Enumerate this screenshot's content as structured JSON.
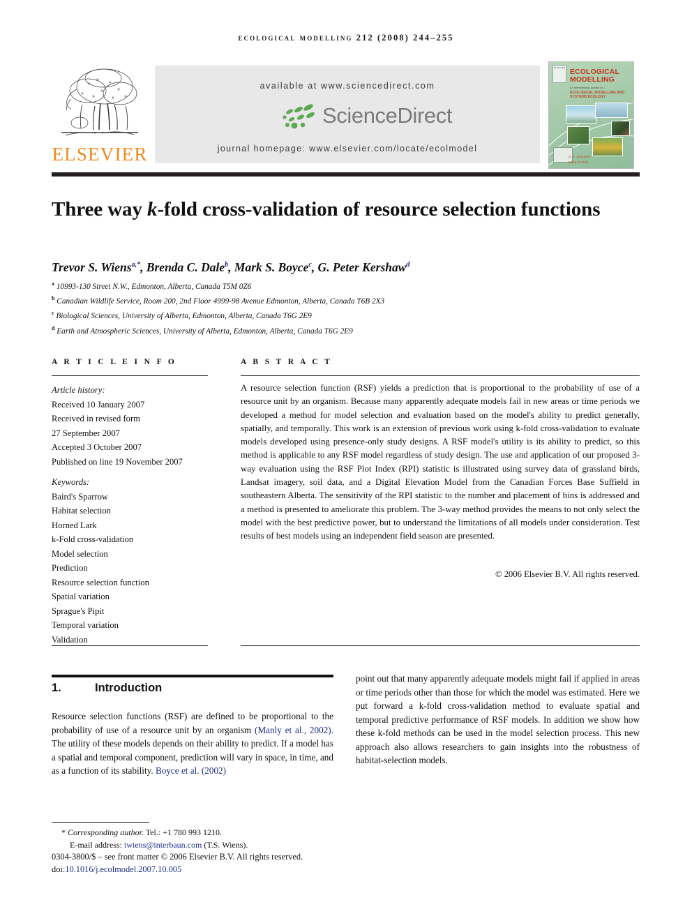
{
  "masthead": {
    "journal_header": "ECOLOGICAL MODELLING 212 (2008) 244–255",
    "elsevier_wordmark": "ELSEVIER",
    "elsevier_logo_icon": "elsevier-tree-icon",
    "sciencedirect": {
      "available_at": "available at www.sciencedirect.com",
      "logo_text": "ScienceDirect",
      "logo_icon": "sciencedirect-leaves-icon",
      "journal_homepage": "journal homepage: www.elsevier.com/locate/ecolmodel"
    },
    "cover": {
      "publisher_mark": "ELSEVIER",
      "title": "ECOLOGICAL MODELLING",
      "subtitle": "An International Journal on",
      "subtitle2": "ECOLOGICAL MODELLING AND SYSTEMS ECOLOGY",
      "editor1": "S. E. Jorgensen",
      "editor2": "Editor-in-Chief"
    }
  },
  "article": {
    "title_part1": "Three way ",
    "title_k": "k",
    "title_part2": "-fold cross-validation of resource selection functions",
    "authors": [
      {
        "name": "Trevor S. Wiens",
        "marks": "a,*"
      },
      {
        "name": "Brenda C. Dale",
        "marks": "b"
      },
      {
        "name": "Mark S. Boyce",
        "marks": "c"
      },
      {
        "name": "G. Peter Kershaw",
        "marks": "d"
      }
    ],
    "affiliations": [
      {
        "mark": "a",
        "text": "10993-130 Street N.W., Edmonton, Alberta, Canada T5M 0Z6"
      },
      {
        "mark": "b",
        "text": "Canadian Wildlife Service, Room 200, 2nd Floor 4999-98 Avenue Edmonton, Alberta, Canada T6B 2X3"
      },
      {
        "mark": "c",
        "text": "Biological Sciences, University of Alberta, Edmonton, Alberta, Canada T6G 2E9"
      },
      {
        "mark": "d",
        "text": "Earth and Atmospheric Sciences, University of Alberta, Edmonton, Alberta, Canada T6G 2E9"
      }
    ]
  },
  "article_info": {
    "heading": "A R T I C L E   I N F O",
    "history_label": "Article history:",
    "history": [
      "Received 10 January 2007",
      "Received in revised form",
      "27 September 2007",
      "Accepted 3 October 2007",
      "Published on line 19 November 2007"
    ],
    "keywords_label": "Keywords:",
    "keywords": [
      "Baird's Sparrow",
      "Habitat selection",
      "Horned Lark",
      "k-Fold cross-validation",
      "Model selection",
      "Prediction",
      "Resource selection function",
      "Spatial variation",
      "Sprague's Pipit",
      "Temporal variation",
      "Validation"
    ]
  },
  "abstract": {
    "heading": "A B S T R A C T",
    "body": "A resource selection function (RSF) yields a prediction that is proportional to the probability of use of a resource unit by an organism. Because many apparently adequate models fail in new areas or time periods we developed a method for model selection and evaluation based on the model's ability to predict generally, spatially, and temporally. This work is an extension of previous work using k-fold cross-validation to evaluate models developed using presence-only study designs. A RSF model's utility is its ability to predict, so this method is applicable to any RSF model regardless of study design. The use and application of our proposed 3-way evaluation using the RSF Plot Index (RPI) statistic is illustrated using survey data of grassland birds, Landsat imagery, soil data, and a Digital Elevation Model from the Canadian Forces Base Suffield in southeastern Alberta. The sensitivity of the RPI statistic to the number and placement of bins is addressed and a method is presented to ameliorate this problem. The 3-way method provides the means to not only select the model with the best predictive power, but to understand the limitations of all models under consideration. Test results of best models using an independent field season are presented.",
    "copyright": "© 2006 Elsevier B.V. All rights reserved."
  },
  "introduction": {
    "number": "1.",
    "heading": "Introduction",
    "left_part1": "Resource selection functions (RSF) are defined to be proportional to the probability of use of a resource unit by an organism ",
    "left_cite1": "(Manly et al., 2002)",
    "left_part2": ". The utility of these models depends on their ability to predict. If a model has a spatial and temporal component, prediction will vary in space, in time, and as a function of its stability. ",
    "left_cite2": "Boyce et al. (2002)",
    "right_text": "point out that many apparently adequate models might fail if applied in areas or time periods other than those for which the model was estimated. Here we put forward a k-fold cross-validation method to evaluate spatial and temporal predictive performance of RSF models. In addition we show how these k-fold methods can be used in the model selection process. This new approach also allows researchers to gain insights into the robustness of habitat-selection models."
  },
  "footnotes": {
    "corresponding_marker": "*",
    "corresponding_label": "Corresponding author.",
    "corresponding_tel": " Tel.: +1 780 993 1210.",
    "email_label": "E-mail address:",
    "email": "twiens@interbaun.com",
    "email_attrib": "(T.S. Wiens).",
    "issn_line": "0304-3800/$ – see front matter © 2006 Elsevier B.V. All rights reserved.",
    "doi_label": "doi:",
    "doi": "10.1016/j.ecolmodel.2007.10.005"
  },
  "colors": {
    "elsevier_orange": "#F08A1C",
    "link_blue": "#1b2f8c",
    "sciencedirect_green": "#5aa84f",
    "sciencedirect_gray": "#7a7a7a",
    "banner_gray": "#e8e8e8",
    "rule_dark": "#231f20"
  }
}
